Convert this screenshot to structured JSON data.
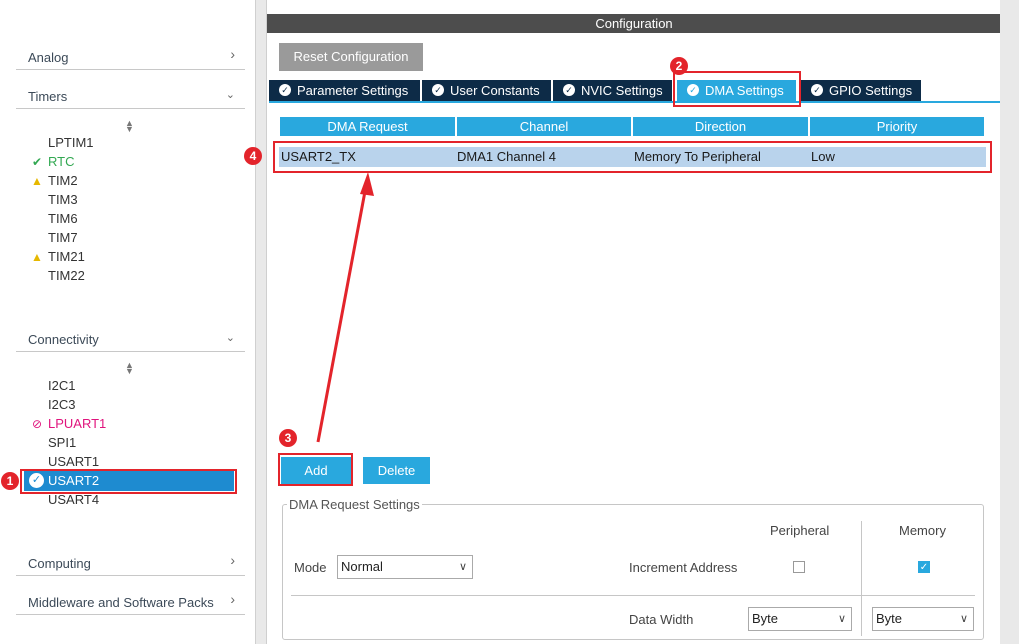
{
  "sidebar": {
    "categories": {
      "analog": "Analog",
      "timers": "Timers",
      "connectivity": "Connectivity",
      "computing": "Computing",
      "middleware": "Middleware and Software Packs"
    },
    "timers": [
      "LPTIM1",
      "RTC",
      "TIM2",
      "TIM3",
      "TIM6",
      "TIM7",
      "TIM21",
      "TIM22"
    ],
    "connectivity": [
      "I2C1",
      "I2C3",
      "LPUART1",
      "SPI1",
      "USART1",
      "USART2",
      "USART4"
    ]
  },
  "config": {
    "title": "Configuration",
    "reset_label": "Reset Configuration",
    "tabs": [
      "Parameter Settings",
      "User Constants",
      "NVIC Settings",
      "DMA Settings",
      "GPIO Settings"
    ],
    "active_tab": "DMA Settings"
  },
  "dma_table": {
    "columns": [
      "DMA Request",
      "Channel",
      "Direction",
      "Priority"
    ],
    "rows": [
      [
        "USART2_TX",
        "DMA1 Channel 4",
        "Memory To Peripheral",
        "Low"
      ]
    ]
  },
  "buttons": {
    "add": "Add",
    "delete": "Delete"
  },
  "request_settings": {
    "title": "DMA Request Settings",
    "peripheral_header": "Peripheral",
    "memory_header": "Memory",
    "mode_label": "Mode",
    "mode_value": "Normal",
    "increment_label": "Increment Address",
    "peripheral_increment": false,
    "memory_increment": true,
    "data_width_label": "Data Width",
    "peripheral_width": "Byte",
    "memory_width": "Byte"
  },
  "annotations": [
    "1",
    "2",
    "3",
    "4"
  ],
  "colors": {
    "accent": "#29a8de",
    "tab_dark": "#0d2b47",
    "selected_row": "#b9d3ec",
    "annotation_red": "#e3242b",
    "ok_green": "#32a852",
    "warning_yellow": "#e6b800",
    "disabled_pink": "#e0147d"
  }
}
